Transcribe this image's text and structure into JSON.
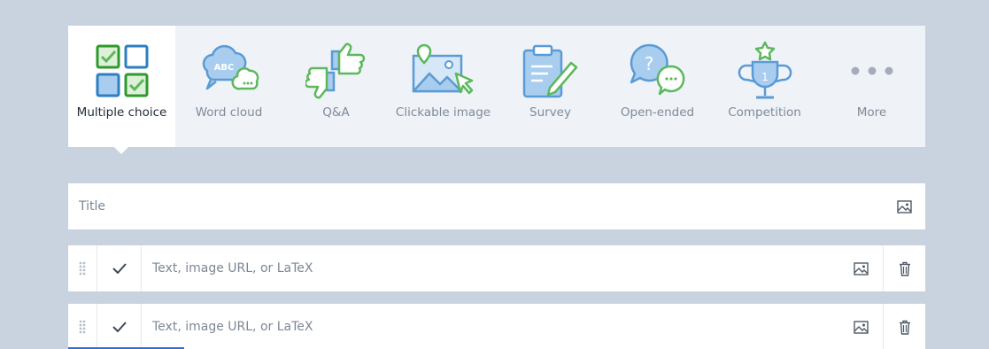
{
  "question_types": [
    {
      "label": "Multiple choice",
      "icon": "multiple-choice-icon",
      "selected": true
    },
    {
      "label": "Word cloud",
      "icon": "word-cloud-icon",
      "icon_text": "ABC"
    },
    {
      "label": "Q&A",
      "icon": "thumbs-up-down-icon"
    },
    {
      "label": "Clickable image",
      "icon": "clickable-image-icon"
    },
    {
      "label": "Survey",
      "icon": "survey-clipboard-icon"
    },
    {
      "label": "Open-ended",
      "icon": "open-ended-icon",
      "icon_text": "?"
    },
    {
      "label": "Competition",
      "icon": "trophy-icon",
      "icon_text": "1"
    },
    {
      "label": "More",
      "icon": "more-dots-icon"
    }
  ],
  "title_field": {
    "placeholder": "Title",
    "value": "",
    "image_icon": "image-icon"
  },
  "options": [
    {
      "placeholder": "Text, image URL, or LaTeX",
      "value": "",
      "correct_icon": "checkmark-icon"
    },
    {
      "placeholder": "Text, image URL, or LaTeX",
      "value": "",
      "correct_icon": "checkmark-icon"
    }
  ],
  "colors": {
    "background": "#c9d3e0",
    "green": "#5cb85c",
    "blue": "#5b9bd5",
    "light_blue": "#a9cdee",
    "active_green": "#2e9a2e",
    "active_blue": "#2d7fc1",
    "focus": "#2b6fd1"
  }
}
